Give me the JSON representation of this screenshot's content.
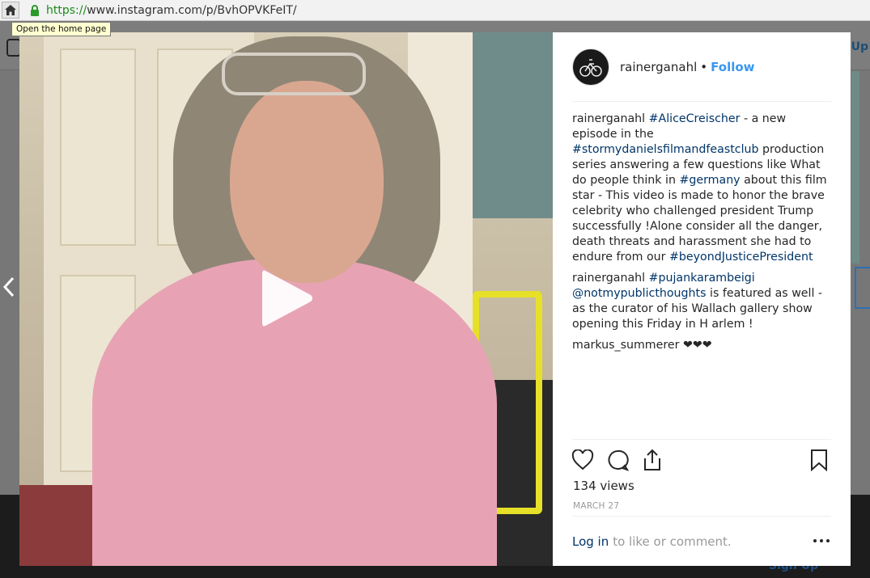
{
  "browser": {
    "url_protocol": "https://",
    "url_rest": "www.instagram.com/p/BvhOPVKFeIT/",
    "tooltip": "Open the home page"
  },
  "background": {
    "right_header_text": "n Up",
    "signup_text": "Sign Up"
  },
  "post": {
    "username": "rainerganahl",
    "separator": "•",
    "follow_label": "Follow",
    "comments": [
      {
        "author": "rainerganahl",
        "parts": [
          {
            "type": "tag",
            "text": "#AliceCreischer"
          },
          {
            "type": "text",
            "text": " - a new episode in the "
          },
          {
            "type": "tag",
            "text": "#stormydanielsfilmandfeastclub"
          },
          {
            "type": "text",
            "text": " production series answering a few questions like What do people think in "
          },
          {
            "type": "tag",
            "text": "#germany"
          },
          {
            "type": "text",
            "text": " about this film star - This video is made to honor the brave celebrity who challenged president Trump successfully !Alone consider all the danger, death threats and harassment she had to endure from our "
          },
          {
            "type": "tag",
            "text": "#beyondJusticePresident"
          }
        ]
      },
      {
        "author": "rainerganahl",
        "parts": [
          {
            "type": "tag",
            "text": "#pujankarambeigi"
          },
          {
            "type": "text",
            "text": " "
          },
          {
            "type": "tag",
            "text": "@notmypublicthoughts"
          },
          {
            "type": "text",
            "text": " is featured as well - as the curator of his Wallach gallery show opening this Friday in H arlem !"
          }
        ]
      },
      {
        "author": "markus_summerer",
        "parts": [
          {
            "type": "text",
            "text": " ❤❤❤"
          }
        ]
      }
    ],
    "views": "134 views",
    "date": "MARCH 27",
    "login_link": "Log in",
    "login_rest": "to like or comment."
  },
  "icons": {
    "home": "home-icon",
    "lock": "lock-icon",
    "play": "play-icon",
    "like": "heart-icon",
    "comment": "comment-icon",
    "share": "share-icon",
    "save": "bookmark-icon",
    "more": "more-options-icon",
    "prev": "chevron-left-icon"
  },
  "colors": {
    "link": "#003569",
    "follow": "#3897f0",
    "text": "#262626",
    "muted": "#999999"
  }
}
